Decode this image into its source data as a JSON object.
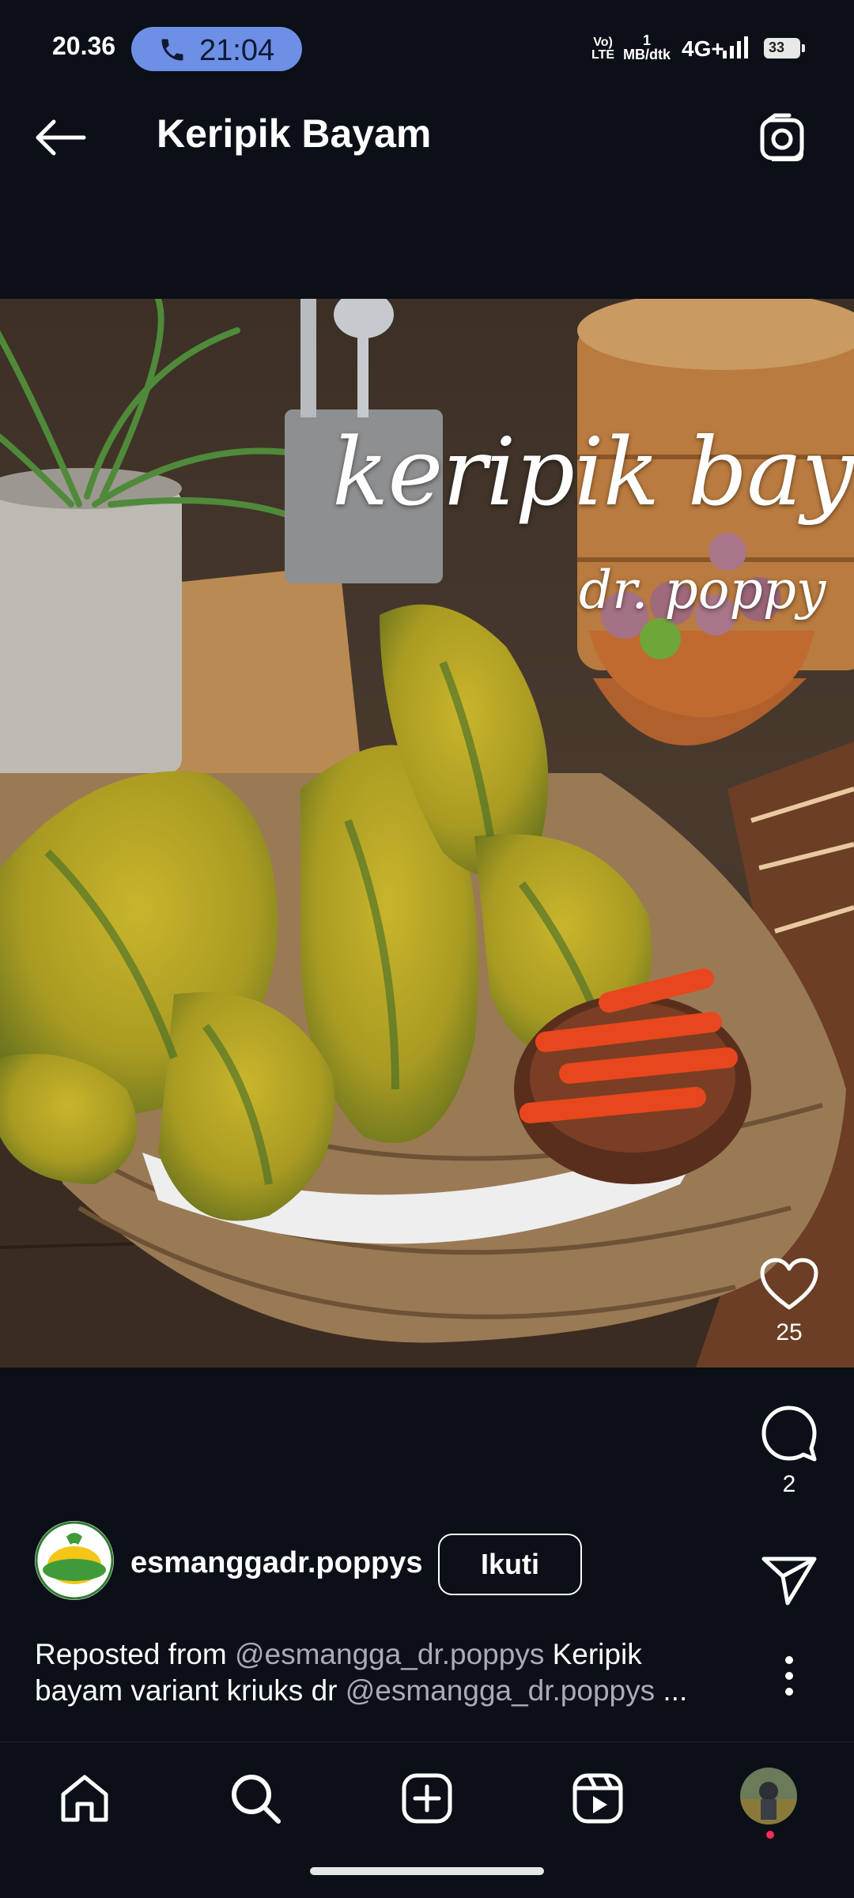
{
  "status_bar": {
    "time": "20.36",
    "call_timer": "21:04",
    "volte_line1": "Vo)",
    "volte_line2": "LTE",
    "speed_value": "1",
    "speed_unit": "MB/dtk",
    "network": "4G+",
    "battery": "33"
  },
  "header": {
    "title": "Keripik Bayam"
  },
  "media": {
    "overlay_title": "keripik bayam",
    "overlay_subtitle": "dr. poppy"
  },
  "actions": {
    "like_count": "25",
    "comment_count": "2"
  },
  "author": {
    "username": "esmanggadr.poppys",
    "follow_label": "Ikuti"
  },
  "caption": {
    "prefix": "Reposted from ",
    "mention1": "@esmangga_dr.poppys",
    "text": " Keripik bayam variant kriuks dr ",
    "mention2": "@esmangga_dr.poppys",
    "ellipsis": " ..."
  },
  "bottom_nav": {
    "items": [
      "home-icon",
      "search-icon",
      "create-icon",
      "reels-icon",
      "profile-avatar"
    ]
  },
  "colors": {
    "background": "#0b0f17",
    "call_pill": "#6d8fe6",
    "mention": "#a8acb3",
    "notification_dot": "#ff2a55"
  }
}
